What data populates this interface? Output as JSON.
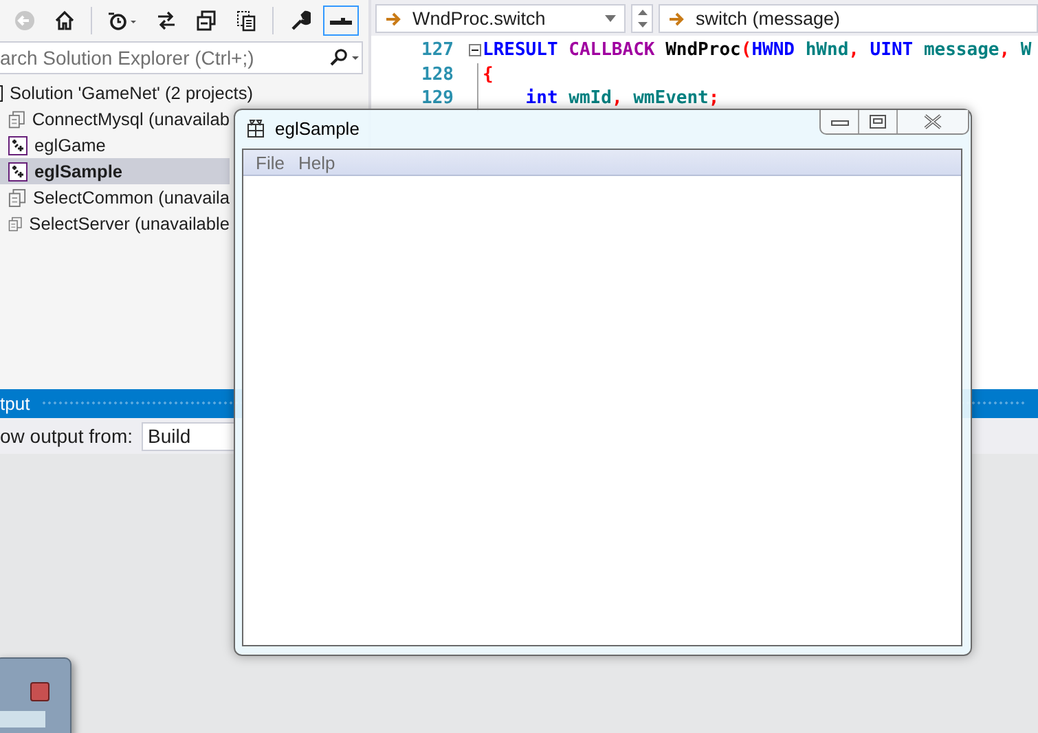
{
  "solution_explorer": {
    "toolbar": [
      {
        "kind": "back",
        "selected": false
      },
      {
        "kind": "home",
        "selected": false
      },
      {
        "kind": "history",
        "selected": false
      },
      {
        "kind": "sync",
        "selected": false
      },
      {
        "kind": "collapse",
        "selected": false
      },
      {
        "kind": "files",
        "selected": false
      },
      {
        "kind": "wrench",
        "selected": false
      },
      {
        "kind": "preview",
        "selected": true
      }
    ],
    "search": {
      "placeholder": "arch Solution Explorer (Ctrl+;)"
    },
    "tree": {
      "label": "Solution 'GameNet' (2 projects)",
      "children": [
        {
          "label": "ConnectMysql (unavailab",
          "kind": "unavailable",
          "selected": false
        },
        {
          "label": "eglGame",
          "kind": "project",
          "selected": false
        },
        {
          "label": "eglSample",
          "kind": "project",
          "selected": true
        },
        {
          "label": "SelectCommon (unavaila",
          "kind": "unavailable",
          "selected": false
        },
        {
          "label": "SelectServer (unavailable",
          "kind": "unavailable",
          "selected": false
        }
      ]
    }
  },
  "editor": {
    "member_dropdown": "WndProc.switch",
    "scope_dropdown": "switch (message)",
    "lines": [
      {
        "number": "127",
        "fold": true,
        "tokens": [
          {
            "text": "LRESULT",
            "kind": "type"
          },
          {
            "text": " CALLBACK",
            "kind": "macro"
          },
          {
            "text": " WndProc",
            "kind": "plain"
          },
          {
            "text": "(",
            "kind": "punct"
          },
          {
            "text": "HWND",
            "kind": "type"
          },
          {
            "text": " hWnd",
            "kind": "param"
          },
          {
            "text": ",",
            "kind": "punct"
          },
          {
            "text": " UINT",
            "kind": "type"
          },
          {
            "text": " message",
            "kind": "param"
          },
          {
            "text": ",",
            "kind": "punct"
          },
          {
            "text": " W",
            "kind": "param"
          }
        ]
      },
      {
        "number": "128",
        "fold": false,
        "tokens": [
          {
            "text": "{",
            "kind": "punct"
          }
        ]
      },
      {
        "number": "129",
        "fold": false,
        "tokens": [
          {
            "text": "    int",
            "kind": "type"
          },
          {
            "text": " wmId",
            "kind": "param"
          },
          {
            "text": ",",
            "kind": "punct"
          },
          {
            "text": " wmEvent",
            "kind": "param"
          },
          {
            "text": ";",
            "kind": "punct"
          }
        ]
      }
    ]
  },
  "output": {
    "title": "tput",
    "source_label": "ow output from:",
    "source": "Build"
  },
  "app_window": {
    "title": "eglSample",
    "menu": [
      "File",
      "Help"
    ]
  }
}
